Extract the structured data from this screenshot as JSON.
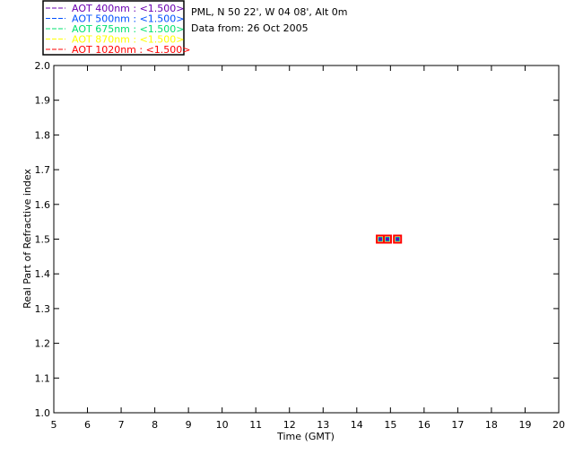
{
  "chart_data": {
    "type": "scatter",
    "title_lines": [
      "PML, N 50 22', W 04 08', Alt 0m",
      "Data from: 26 Oct 2005"
    ],
    "xlabel": "Time (GMT)",
    "ylabel": "Real Part of Refractive index",
    "xlim": [
      5,
      20
    ],
    "ylim": [
      1.0,
      2.0
    ],
    "xticks": [
      "5",
      "6",
      "7",
      "8",
      "9",
      "10",
      "11",
      "12",
      "13",
      "14",
      "15",
      "16",
      "17",
      "18",
      "19",
      "20"
    ],
    "yticks": [
      "1.0",
      "1.1",
      "1.2",
      "1.3",
      "1.4",
      "1.5",
      "1.6",
      "1.7",
      "1.8",
      "1.9",
      "2.0"
    ],
    "grid": false,
    "legend_position": "top-left",
    "series": [
      {
        "name": "AOT  400nm : <1.500>",
        "color": "#6a00b0",
        "x": [
          14.7,
          14.91,
          15.21
        ],
        "y": [
          1.5,
          1.5,
          1.5
        ]
      },
      {
        "name": "AOT  500nm : <1.500>",
        "color": "#0050ff",
        "x": [
          14.7,
          14.91,
          15.21
        ],
        "y": [
          1.5,
          1.5,
          1.5
        ]
      },
      {
        "name": "AOT  675nm : <1.500>",
        "color": "#00e070",
        "x": [
          14.7,
          14.91,
          15.21
        ],
        "y": [
          1.5,
          1.5,
          1.5
        ]
      },
      {
        "name": "AOT  870nm : <1.500>",
        "color": "#ffff00",
        "x": [
          14.7,
          14.91,
          15.21
        ],
        "y": [
          1.5,
          1.5,
          1.5
        ]
      },
      {
        "name": "AOT 1020nm : <1.500>",
        "color": "#ff0000",
        "x": [
          14.7,
          14.91,
          15.21
        ],
        "y": [
          1.5,
          1.5,
          1.5
        ]
      }
    ]
  }
}
